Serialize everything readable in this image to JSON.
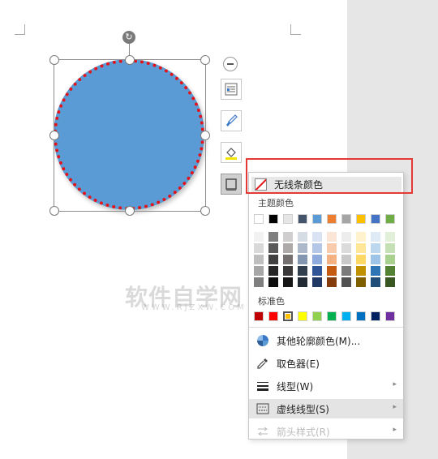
{
  "outline_menu": {
    "no_line_color": "无线条颜色",
    "theme_colors_heading": "主题颜色",
    "theme_colors_row": [
      "#ffffff",
      "#000000",
      "#e7e6e6",
      "#44546a",
      "#5b9bd5",
      "#ed7d31",
      "#a5a5a5",
      "#ffc000",
      "#4472c4",
      "#70ad47"
    ],
    "theme_shades": [
      [
        "#f2f2f2",
        "#7f7f7f",
        "#d0cece",
        "#d6dce4",
        "#dae3f3",
        "#fbe5d6",
        "#ededed",
        "#fff2cc",
        "#deebf7",
        "#e2f0d9"
      ],
      [
        "#d9d9d9",
        "#595959",
        "#aeaaaa",
        "#adb9ca",
        "#b4c7e7",
        "#f8cbad",
        "#dbdbdb",
        "#ffe699",
        "#bdd7ee",
        "#c5e0b4"
      ],
      [
        "#bfbfbf",
        "#404040",
        "#757171",
        "#8497b0",
        "#8faadc",
        "#f4b183",
        "#c9c9c9",
        "#ffd966",
        "#9dc3e6",
        "#a9d18e"
      ],
      [
        "#a6a6a6",
        "#262626",
        "#3a3838",
        "#323f4f",
        "#2f5597",
        "#c55a11",
        "#7b7b7b",
        "#bf9000",
        "#2e75b6",
        "#548235"
      ],
      [
        "#7f7f7f",
        "#0d0d0d",
        "#171616",
        "#222a35",
        "#1f3864",
        "#843c0c",
        "#525252",
        "#7f6000",
        "#1f4e79",
        "#385723"
      ]
    ],
    "standard_colors_heading": "标准色",
    "standard_colors": [
      "#c00000",
      "#ff0000",
      "#ffc000",
      "#ffff00",
      "#92d050",
      "#00b050",
      "#00b0f0",
      "#0070c0",
      "#002060",
      "#7030a0"
    ],
    "standard_selected_index": 2,
    "items": [
      {
        "label": "其他轮廓颜色(M)...",
        "icon": "palette-icon"
      },
      {
        "label": "取色器(E)",
        "icon": "eyedropper-icon"
      },
      {
        "label": "线型(W)",
        "icon": "line-weight-icon",
        "submenu": true
      },
      {
        "label": "虚线线型(S)",
        "icon": "dash-type-icon",
        "submenu": true,
        "hover": true
      },
      {
        "label": "箭头样式(R)",
        "icon": "arrow-style-icon",
        "submenu": true,
        "disabled": true
      }
    ]
  },
  "shape": {
    "fill_color": "#5b9bd5",
    "outline_color": "#e0141a",
    "outline_style": "dotted"
  },
  "watermark": {
    "main": "软件自学网",
    "sub": "WWW.RJZXW.COM"
  }
}
